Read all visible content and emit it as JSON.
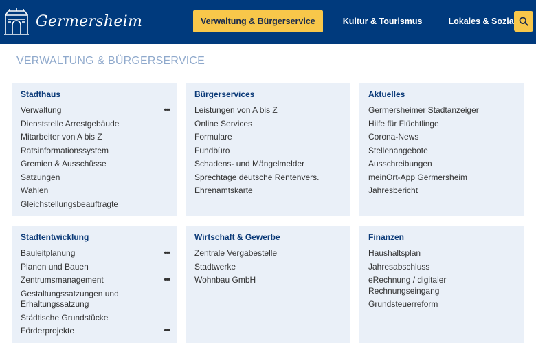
{
  "header": {
    "logo_text": "Germersheim",
    "nav": [
      {
        "label": "Verwaltung & Bürgerservice",
        "active": true
      },
      {
        "label": "Kultur & Tourismus",
        "active": false
      },
      {
        "label": "Lokales & Soziales",
        "active": false
      }
    ],
    "search_icon": "search-icon"
  },
  "page_title": "VERWALTUNG & BÜRGERSERVICE",
  "cards": [
    {
      "title": "Stadthaus",
      "items": [
        {
          "label": "Verwaltung",
          "more": "•••"
        },
        {
          "label": "Dienststelle Arrestgebäude"
        },
        {
          "label": "Mitarbeiter von A bis Z"
        },
        {
          "label": "Ratsinformationssystem"
        },
        {
          "label": "Gremien & Ausschüsse"
        },
        {
          "label": "Satzungen"
        },
        {
          "label": "Wahlen"
        },
        {
          "label": "Gleichstellungsbeauftragte"
        }
      ]
    },
    {
      "title": "Bürgerservices",
      "items": [
        {
          "label": "Leistungen von A bis Z"
        },
        {
          "label": "Online Services"
        },
        {
          "label": "Formulare"
        },
        {
          "label": "Fundbüro"
        },
        {
          "label": "Schadens- und Mängelmelder"
        },
        {
          "label": "Sprechtage deutsche Rentenvers."
        },
        {
          "label": "Ehrenamtskarte"
        }
      ]
    },
    {
      "title": "Aktuelles",
      "items": [
        {
          "label": "Germersheimer Stadtanzeiger"
        },
        {
          "label": "Hilfe für Flüchtlinge"
        },
        {
          "label": "Corona-News"
        },
        {
          "label": "Stellenangebote"
        },
        {
          "label": "Ausschreibungen"
        },
        {
          "label": "meinOrt-App Germersheim"
        },
        {
          "label": "Jahresbericht"
        }
      ]
    },
    {
      "title": "Stadtentwicklung",
      "items": [
        {
          "label": "Bauleitplanung",
          "more": "•••"
        },
        {
          "label": "Planen und Bauen"
        },
        {
          "label": "Zentrumsmanagement",
          "more": "•••"
        },
        {
          "label": "Gestaltungssatzungen und Erhaltungssatzung"
        },
        {
          "label": "Städtische Grundstücke"
        },
        {
          "label": "Förderprojekte",
          "more": "•••"
        }
      ]
    },
    {
      "title": "Wirtschaft & Gewerbe",
      "items": [
        {
          "label": "Zentrale Vergabestelle"
        },
        {
          "label": "Stadtwerke"
        },
        {
          "label": "Wohnbau GmbH"
        }
      ]
    },
    {
      "title": "Finanzen",
      "items": [
        {
          "label": "Haushaltsplan"
        },
        {
          "label": "Jahresabschluss"
        },
        {
          "label": "eRechnung / digitaler Rechnungseingang"
        },
        {
          "label": "Grundsteuerreform"
        }
      ]
    }
  ]
}
